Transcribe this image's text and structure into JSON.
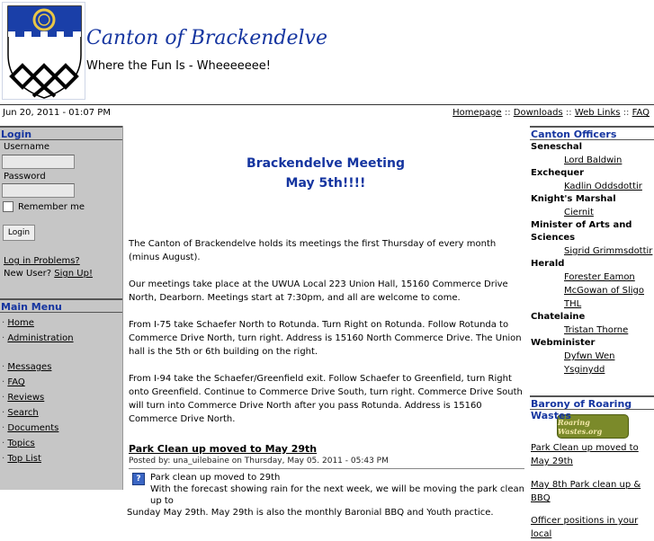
{
  "site": {
    "title": "Canton of Brackendelve",
    "slogan": "Where the Fun Is - Wheeeeeee!"
  },
  "datebar": {
    "date": "Jun 20, 2011 - 01:07 PM",
    "links": [
      "Homepage",
      "Downloads",
      "Web Links",
      "FAQ"
    ],
    "separator": "::"
  },
  "login": {
    "title": "Login",
    "username_label": "Username",
    "username_value": "",
    "password_label": "Password",
    "password_value": "",
    "remember_label": "Remember me",
    "button_label": "Login",
    "problems_link": "Log in Problems?",
    "new_user_text": "New User?",
    "signup_link": "Sign Up!"
  },
  "main_menu": {
    "title": "Main Menu",
    "bullet": "·",
    "group1": [
      "Home",
      "Administration"
    ],
    "group2": [
      "Messages",
      "FAQ",
      "Reviews",
      "Search",
      "Documents",
      "Topics",
      "Top List"
    ]
  },
  "main": {
    "headline_line1": "Brackendelve Meeting",
    "headline_line2": "May 5th!!!!",
    "paragraphs": [
      "The Canton of Brackendelve holds its meetings the first Thursday of every month (minus August).",
      "Our meetings take place at the UWUA Local 223 Union Hall, 15160 Commerce Drive North, Dearborn. Meetings start at 7:30pm, and all are welcome to come.",
      "From I-75 take Schaefer North to Rotunda. Turn Right on Rotunda. Follow Rotunda to Commerce Drive North, turn right. Address is 15160 North Commerce Drive. The Union hall is the 5th or 6th building on the right.",
      "From I-94 take the Schaefer/Greenfield exit. Follow Schaefer to Greenfield, turn Right onto Greenfield. Continue to Commerce Drive South, turn right. Commerce Drive South will turn into Commerce Drive North after you pass Rotunda. Address is 15160 Commerce Drive North."
    ],
    "story": {
      "title": "Park Clean up moved to May 29th",
      "meta": "Posted by: una_uilebaine on Thursday, May 05. 2011 - 05:43 PM",
      "icon": "?",
      "line1": "Park clean up moved to 29th",
      "line2": "With the forecast showing rain for the next week, we will be moving the park clean up to",
      "line3": "Sunday May 29th. May 29th is also the monthly Baronial BBQ and Youth practice."
    }
  },
  "officers": {
    "title": "Canton Officers",
    "groups": [
      {
        "role": "Seneschal",
        "people": [
          "Lord Baldwin"
        ]
      },
      {
        "role": "Exchequer",
        "people": [
          "Kadlin Oddsdottir"
        ]
      },
      {
        "role": "Knight's Marshal",
        "people": [
          "Ciernit"
        ]
      },
      {
        "role": "Minister of Arts and Sciences",
        "people": [
          "Sigrid Grimmsdottir"
        ]
      },
      {
        "role": "Herald",
        "people": [
          "Forester Eamon",
          "McGowan of Sligo",
          "THL"
        ]
      },
      {
        "role": "Chatelaine",
        "people": [
          "Tristan Thorne"
        ]
      },
      {
        "role": "Webminister",
        "people": [
          "Dyfwn Wen Ysginydd"
        ]
      }
    ]
  },
  "barony": {
    "title": "Barony of Roaring Wastes",
    "logo_text": "Roaring Wastes.org",
    "news": [
      "Park Clean up moved to May 29th",
      "May 8th Park clean up & BBQ",
      "Officer positions in your local"
    ]
  }
}
